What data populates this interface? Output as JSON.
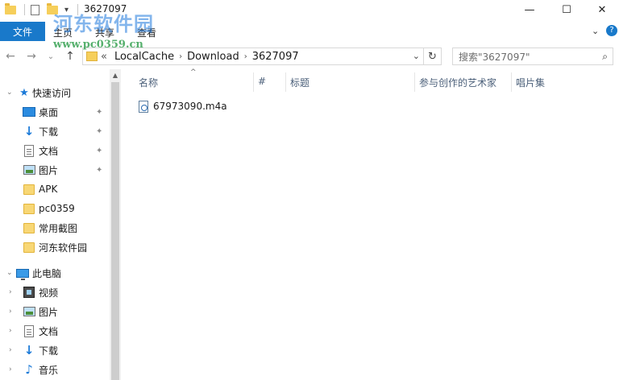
{
  "window": {
    "title": "3627097",
    "min_glyph": "—",
    "max_glyph": "☐",
    "close_glyph": "✕"
  },
  "quick_access_toolbar": {
    "dropdown_glyph": "▾"
  },
  "ribbon": {
    "file_tab": "文件",
    "tabs": [
      "主页",
      "共享",
      "查看"
    ],
    "collapse_glyph": "⌄",
    "help_glyph": "?"
  },
  "watermark": {
    "line1": "河东软件园",
    "line2": "www.pc0359.cn"
  },
  "nav": {
    "back_glyph": "←",
    "forward_glyph": "→",
    "recent_glyph": "⌄",
    "up_glyph": "↑"
  },
  "address": {
    "overflow": "«",
    "crumbs": [
      "LocalCache",
      "Download",
      "3627097"
    ],
    "separator": "›",
    "dropdown_glyph": "⌄",
    "refresh_glyph": "↻"
  },
  "search": {
    "placeholder": "搜索\"3627097\"",
    "icon_glyph": "⌕"
  },
  "sidebar": {
    "quick_access": {
      "label": "快速访问",
      "items": [
        {
          "label": "桌面",
          "icon": "desktop-icon",
          "pinned": true
        },
        {
          "label": "下载",
          "icon": "download-icon",
          "pinned": true
        },
        {
          "label": "文档",
          "icon": "document-icon",
          "pinned": true
        },
        {
          "label": "图片",
          "icon": "pictures-icon",
          "pinned": true
        },
        {
          "label": "APK",
          "icon": "folder-icon",
          "pinned": false
        },
        {
          "label": "pc0359",
          "icon": "folder-icon",
          "pinned": false
        },
        {
          "label": "常用截图",
          "icon": "folder-icon",
          "pinned": false
        },
        {
          "label": "河东软件园",
          "icon": "folder-icon",
          "pinned": false
        }
      ]
    },
    "this_pc": {
      "label": "此电脑",
      "items": [
        {
          "label": "视频",
          "icon": "videos-icon"
        },
        {
          "label": "图片",
          "icon": "pictures-icon"
        },
        {
          "label": "文档",
          "icon": "document-icon"
        },
        {
          "label": "下载",
          "icon": "download-icon"
        },
        {
          "label": "音乐",
          "icon": "music-icon"
        }
      ]
    },
    "pin_glyph": "📌",
    "expanded_glyph": "⌄",
    "collapsed_glyph": "›"
  },
  "columns": {
    "name": "名称",
    "number": "#",
    "title": "标题",
    "artist": "参与创作的艺术家",
    "album": "唱片集",
    "sort_glyph": "^"
  },
  "files": [
    {
      "name": "67973090.m4a",
      "icon": "audio-file-icon"
    }
  ],
  "colors": {
    "accent": "#1979ca",
    "header_text": "#4c607a"
  }
}
